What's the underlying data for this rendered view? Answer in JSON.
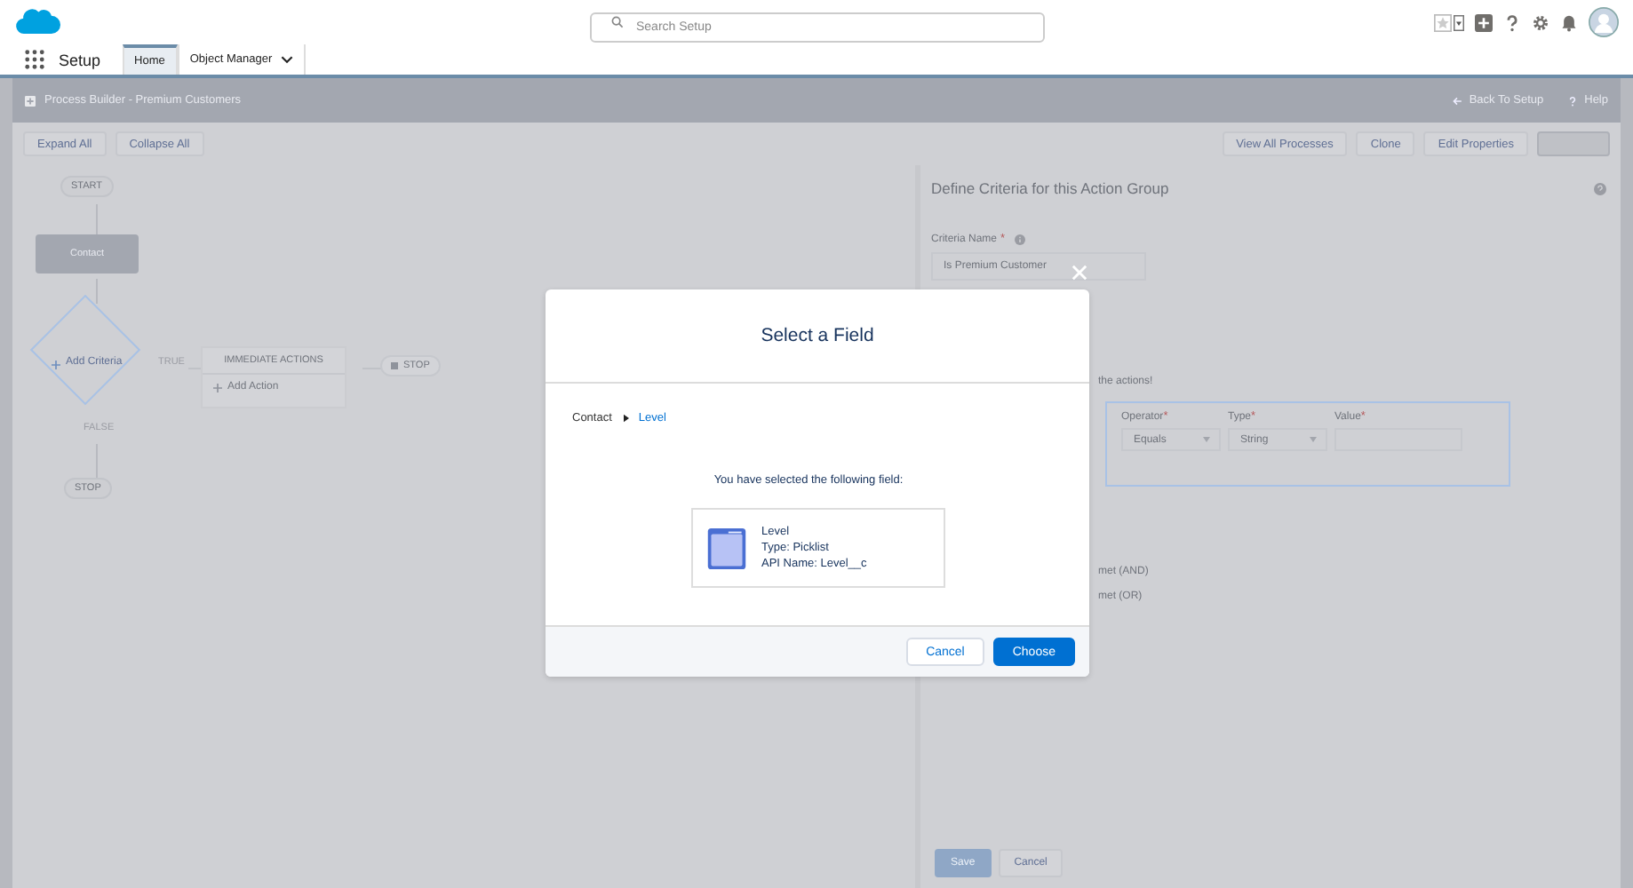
{
  "header": {
    "search": {
      "placeholder": "Search Setup"
    }
  },
  "nav": {
    "app_name": "Setup",
    "tabs": [
      {
        "label": "Home",
        "selected": true,
        "kind": "tab"
      },
      {
        "label": "Object Manager",
        "selected": false,
        "kind": "menu"
      }
    ]
  },
  "builder": {
    "title": "Process Builder - Premium Customers",
    "links": [
      "Back To Setup",
      "Help"
    ],
    "toolbar_left": [
      "Expand All",
      "Collapse All"
    ],
    "toolbar_right": [
      "View All Processes",
      "Clone",
      "Edit Properties"
    ],
    "canvas": {
      "start": "START",
      "object": "Contact",
      "criteria": "Add Criteria",
      "true_label": "TRUE",
      "false_label": "FALSE",
      "actions_title": "IMMEDIATE ACTIONS",
      "add_action": "Add Action",
      "stop_right": "STOP",
      "stop_bottom": "STOP"
    },
    "panel": {
      "title": "Define Criteria for this Action Group",
      "criteria_label": "Criteria Name",
      "criteria_required": "*",
      "criteria_value": "Is Premium Customer",
      "partial_actions": "the actions!",
      "condition": {
        "operator_label": "Operator",
        "operator_required": "*",
        "operator": "Equals",
        "type_label": "Type",
        "type_required": "*",
        "type": "String",
        "value_label": "Value",
        "value_required": "*"
      },
      "partial_and": "met (AND)",
      "partial_or": "met (OR)",
      "save": "Save",
      "cancel": "Cancel"
    }
  },
  "modal": {
    "title": "Select a Field",
    "breadcrumb": [
      "Contact",
      "Level"
    ],
    "message": "You have selected the following field:",
    "field": {
      "name": "Level",
      "type": "Type: Picklist",
      "api_name": "API Name: Level__c"
    },
    "buttons": [
      {
        "label": "Cancel",
        "kind": "neutral"
      },
      {
        "label": "Choose",
        "kind": "brand"
      }
    ]
  }
}
